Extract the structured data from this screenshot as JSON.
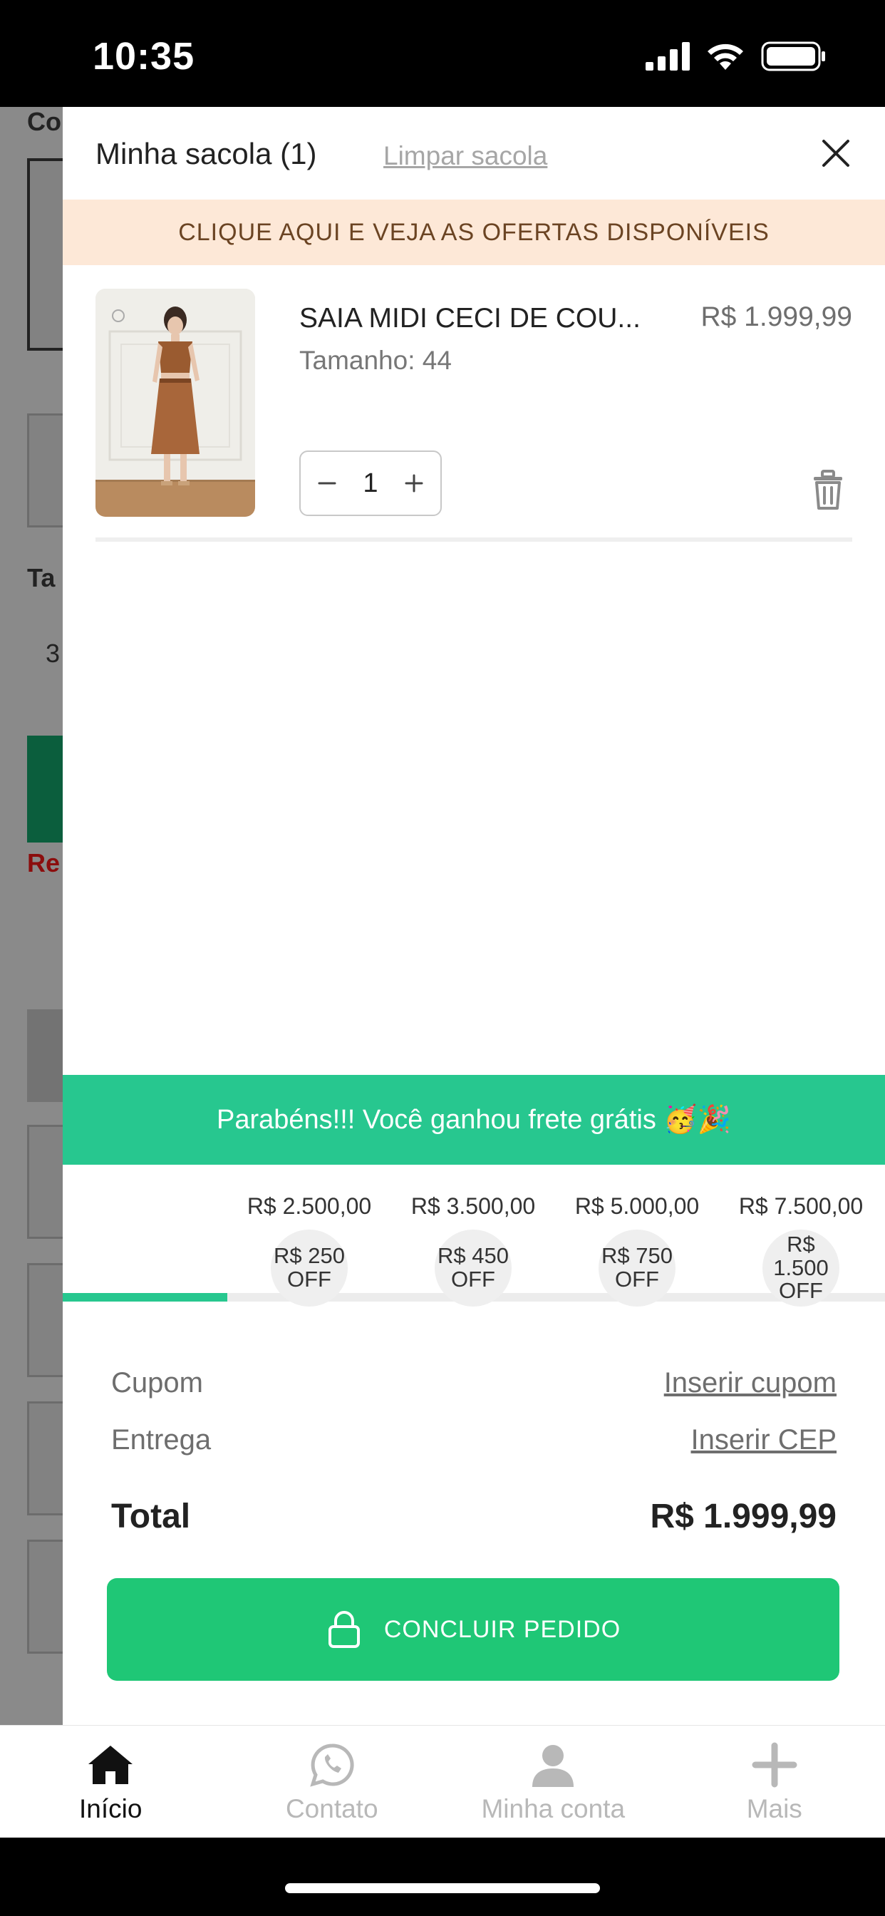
{
  "status_bar": {
    "time": "10:35"
  },
  "background_page": {
    "label_1": "Co",
    "label_2": "Ta",
    "label_3": "3",
    "label_4": "Re"
  },
  "drawer": {
    "title": "Minha sacola (1)",
    "clear_label": "Limpar sacola",
    "offers_banner": "CLIQUE AQUI E VEJA AS OFERTAS DISPONÍVEIS"
  },
  "cart_item": {
    "name": "SAIA MIDI CECI DE COU...",
    "price": "R$ 1.999,99",
    "size": "Tamanho: 44",
    "quantity": "1"
  },
  "free_shipping": {
    "message": "Parabéns!!! Você ganhou frete grátis 🥳🎉"
  },
  "progress": {
    "fraction": 0.2,
    "tiers": [
      {
        "threshold": "R$ 2.500,00",
        "discount": "R$ 250",
        "off": "OFF"
      },
      {
        "threshold": "R$ 3.500,00",
        "discount": "R$ 450",
        "off": "OFF"
      },
      {
        "threshold": "R$ 5.000,00",
        "discount": "R$ 750",
        "off": "OFF"
      },
      {
        "threshold": "R$ 7.500,00",
        "discount": "R$ 1.500",
        "off": "OFF"
      }
    ]
  },
  "summary": {
    "coupon_label": "Cupom",
    "coupon_link": "Inserir cupom",
    "delivery_label": "Entrega",
    "delivery_link": "Inserir CEP",
    "total_label": "Total",
    "total_value": "R$ 1.999,99"
  },
  "checkout": {
    "label": "CONCLUIR PEDIDO"
  },
  "nav": {
    "items": [
      {
        "label": "Início",
        "icon": "home-icon",
        "active": true
      },
      {
        "label": "Contato",
        "icon": "whatsapp-icon",
        "active": false
      },
      {
        "label": "Minha conta",
        "icon": "user-icon",
        "active": false
      },
      {
        "label": "Mais",
        "icon": "plus-icon",
        "active": false
      }
    ]
  },
  "colors": {
    "accent_green": "#27c78f",
    "checkout_green": "#1fc776",
    "banner_bg": "#fde8d7",
    "banner_text": "#6b4423"
  }
}
